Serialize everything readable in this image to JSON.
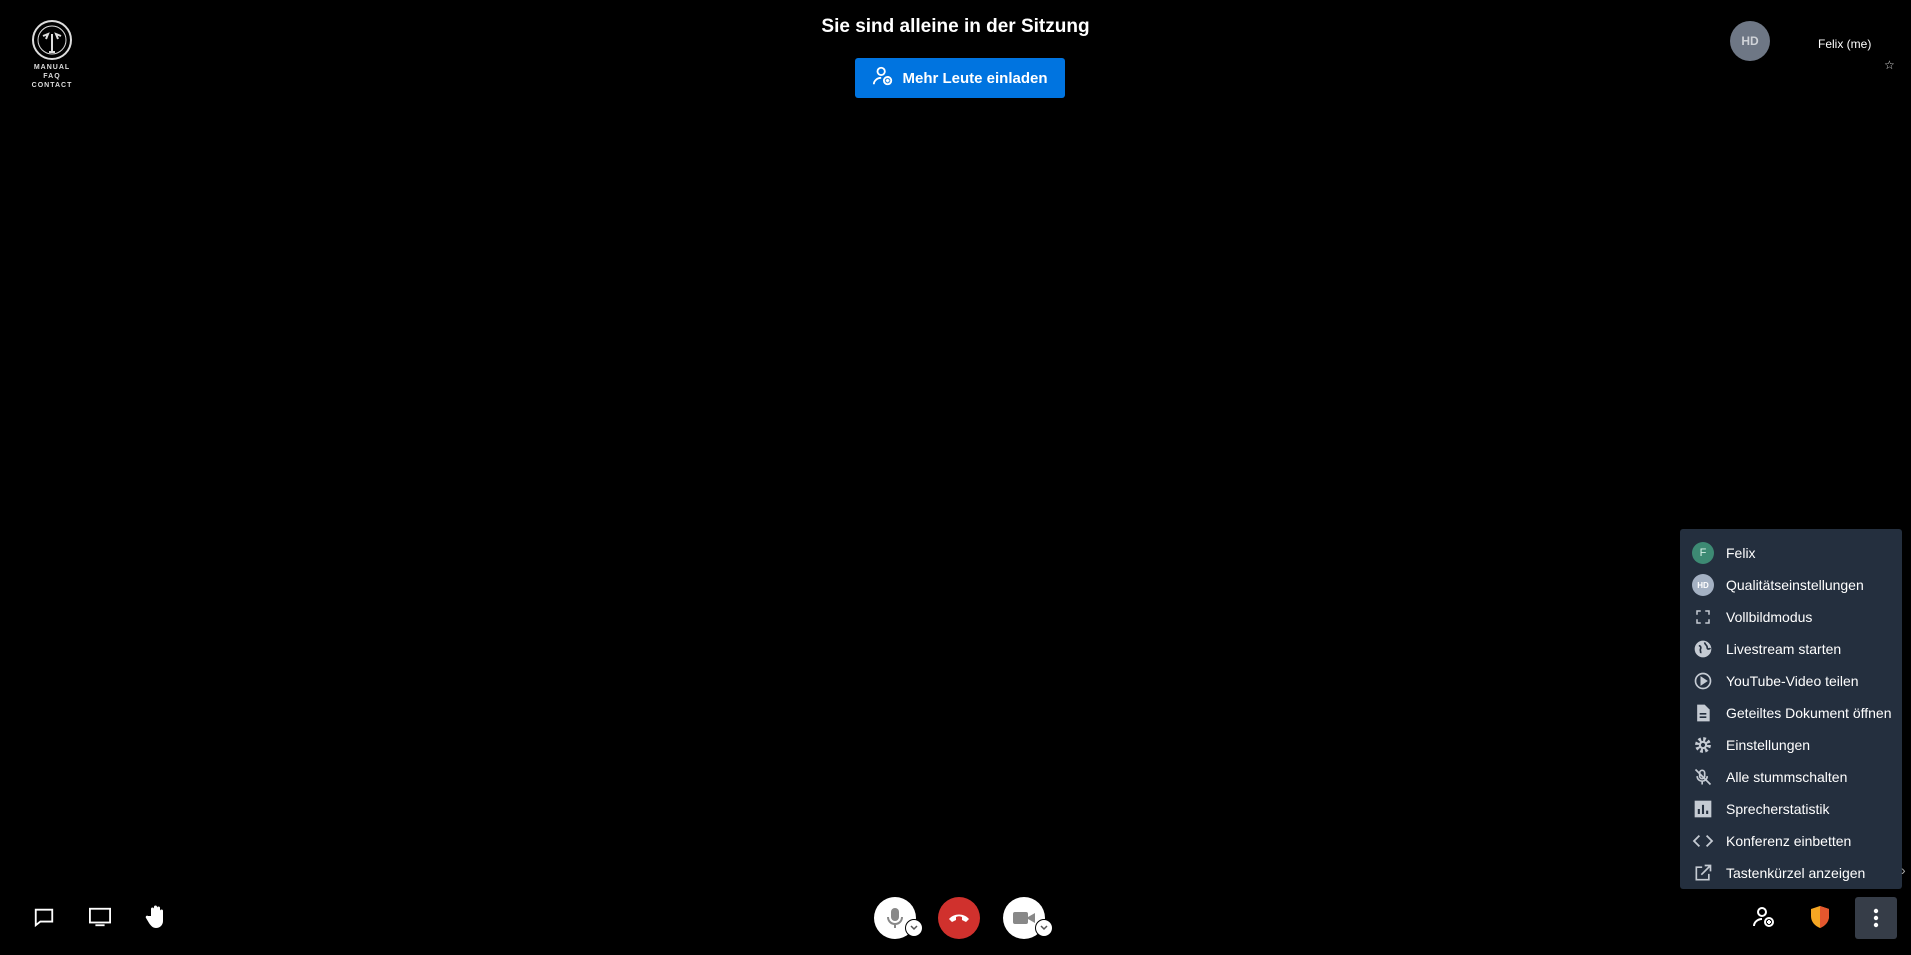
{
  "logo": {
    "lines": [
      "MANUAL",
      "FAQ",
      "CONTACT"
    ]
  },
  "header": {
    "title": "Sie sind alleine in der Sitzung",
    "invite_label": "Mehr Leute einladen"
  },
  "top_right": {
    "quality_avatar": "HD",
    "me_label": "Felix (me)",
    "pin_icon": "pin-icon"
  },
  "menu": {
    "items": [
      {
        "label": "Felix",
        "icon": "avatar-f",
        "badge": "F"
      },
      {
        "label": "Qualitätseinstellungen",
        "icon": "hd-icon",
        "badge": "HD"
      },
      {
        "label": "Vollbildmodus",
        "icon": "fullscreen-icon"
      },
      {
        "label": "Livestream starten",
        "icon": "globe-icon"
      },
      {
        "label": "YouTube-Video teilen",
        "icon": "play-circle-icon"
      },
      {
        "label": "Geteiltes Dokument öffnen",
        "icon": "document-icon"
      },
      {
        "label": "Einstellungen",
        "icon": "gear-icon"
      },
      {
        "label": "Alle stummschalten",
        "icon": "mute-all-icon"
      },
      {
        "label": "Sprecherstatistik",
        "icon": "stats-icon"
      },
      {
        "label": "Konferenz einbetten",
        "icon": "embed-code-icon"
      },
      {
        "label": "Tastenkürzel anzeigen",
        "icon": "external-link-icon"
      }
    ]
  },
  "toolbar": {
    "left": [
      "chat-icon",
      "screen-share-icon",
      "raise-hand-icon"
    ],
    "center": [
      "microphone-icon",
      "hangup-icon",
      "camera-icon"
    ],
    "right": [
      "invite-people-icon",
      "security-shield-icon",
      "more-vertical-icon"
    ],
    "colors": {
      "hangup": "#d0312d",
      "shield": "#f5a623",
      "accent": "#0074e0"
    }
  }
}
